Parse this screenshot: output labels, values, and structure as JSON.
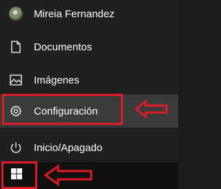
{
  "menu": {
    "user": {
      "label": "Mireia Fernandez",
      "icon": "user-avatar-icon"
    },
    "items": [
      {
        "label": "Documentos",
        "icon": "document-icon"
      },
      {
        "label": "Imágenes",
        "icon": "image-icon"
      },
      {
        "label": "Configuración",
        "icon": "gear-icon",
        "highlighted": true
      },
      {
        "label": "Inicio/Apagado",
        "icon": "power-icon"
      }
    ]
  },
  "taskbar": {
    "start_icon": "windows-logo-icon"
  },
  "annotations": {
    "color": "#e31b24",
    "arrow_icon": "left-arrow-outline-icon"
  }
}
